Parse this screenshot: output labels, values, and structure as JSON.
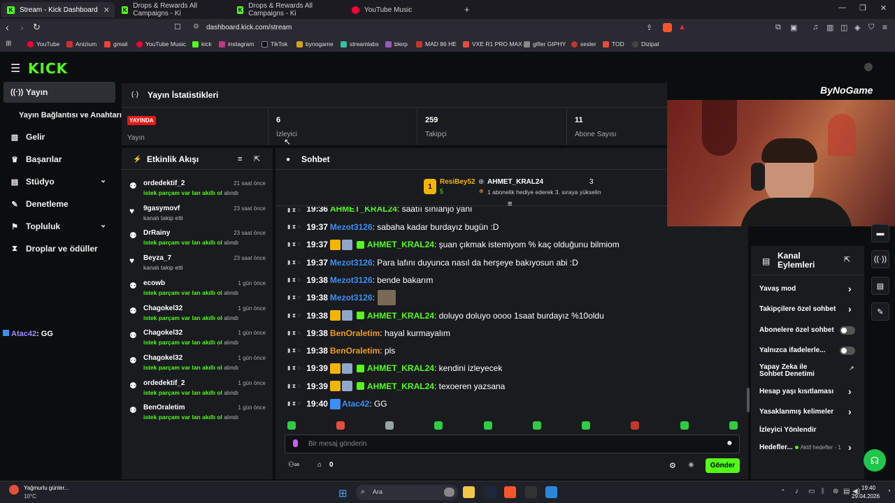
{
  "browser": {
    "tabs": [
      {
        "title": "Stream - Kick Dashboard",
        "icon": "kick-icon"
      },
      {
        "title": "Drops & Rewards All Campaigns - Ki",
        "icon": "kick-icon"
      },
      {
        "title": "Drops & Rewards All Campaigns - Ki",
        "icon": "kick-icon"
      },
      {
        "title": "YouTube Music",
        "icon": "youtube-music-icon"
      }
    ],
    "url": "dashboard.kick.com/stream",
    "bookmarks": [
      "YouTube",
      "Anizium",
      "gmail",
      "YouTube Music",
      "kick",
      "instagram",
      "TikTok",
      "bynogame",
      "streamlabs",
      "blerp",
      "MAD 86 HE",
      "VXE R1 PRO MAX",
      "gifler GIPHY",
      "sesler",
      "TOD",
      "Dizipal"
    ]
  },
  "sidebar": {
    "items": [
      {
        "label": "Yayın",
        "icon": "broadcast-icon"
      },
      {
        "label": "Yayın Bağlantısı ve Anahtarı",
        "icon": ""
      },
      {
        "label": "Gelir",
        "icon": "chart-icon"
      },
      {
        "label": "Başarılar",
        "icon": "trophy-icon"
      },
      {
        "label": "Stüdyo",
        "icon": "studio-icon"
      },
      {
        "label": "Denetleme",
        "icon": "wrench-icon"
      },
      {
        "label": "Topluluk",
        "icon": "community-icon"
      },
      {
        "label": "Droplar ve ödüller",
        "icon": "drops-icon"
      }
    ],
    "overlay_chat": {
      "user": "Atac42",
      "text": ": GG"
    }
  },
  "stats": {
    "title": "Yayın İstatistikleri",
    "live_badge": "YAYINDA",
    "live_label": "Yayın",
    "viewers": {
      "value": "6",
      "label": "İzleyici"
    },
    "followers": {
      "value": "259",
      "label": "Takipçi"
    },
    "subs": {
      "value": "11",
      "label": "Abone Sayısı"
    }
  },
  "activity": {
    "title": "Etkinlik Akışı",
    "items": [
      {
        "user": "ordedektif_2",
        "time": "21 saat önce",
        "desc_bold": "istek parçam var lan akıllı ol",
        "desc": " alındı",
        "kind": "redeem"
      },
      {
        "user": "9gasymovf",
        "time": "23 saat önce",
        "desc_bold": "",
        "desc": "kanalı takip etti",
        "kind": "follow"
      },
      {
        "user": "DrRainy",
        "time": "23 saat önce",
        "desc_bold": "istek parçam var lan akıllı ol",
        "desc": " alındı",
        "kind": "redeem"
      },
      {
        "user": "Beyza_7",
        "time": "23 saat önce",
        "desc_bold": "",
        "desc": "kanalı takip etti",
        "kind": "follow"
      },
      {
        "user": "ecowb",
        "time": "1 gün önce",
        "desc_bold": "istek parçam var lan akıllı ol",
        "desc": " alındı",
        "kind": "redeem"
      },
      {
        "user": "Chagokel32",
        "time": "1 gün önce",
        "desc_bold": "istek parçam var lan akıllı ol",
        "desc": " alındı",
        "kind": "redeem"
      },
      {
        "user": "Chagokel32",
        "time": "1 gün önce",
        "desc_bold": "istek parçam var lan akıllı ol",
        "desc": " alındı",
        "kind": "redeem"
      },
      {
        "user": "Chagokel32",
        "time": "1 gün önce",
        "desc_bold": "istek parçam var lan akıllı ol",
        "desc": " alındı",
        "kind": "redeem"
      },
      {
        "user": "ordedektif_2",
        "time": "1 gün önce",
        "desc_bold": "istek parçam var lan akıllı ol",
        "desc": " alındı",
        "kind": "redeem"
      },
      {
        "user": "BenOraletim",
        "time": "1 gün önce",
        "desc_bold": "istek parçam var lan akıllı ol",
        "desc": " alındı",
        "kind": "redeem"
      }
    ]
  },
  "chat": {
    "title": "Sohbet",
    "pinned": {
      "rank": "1",
      "user1": "ResiBey52",
      "user1_count": "5",
      "user2": "AHMET_KRAL24",
      "user2_count": "3",
      "text": "1 abonelik hediye ederek 3. sıraya yükselin"
    },
    "partial_top": {
      "time": "19:36",
      "user": "AHMET_KRAL24",
      "text": ": saatıı sınıanjo yanı"
    },
    "messages": [
      {
        "time": "19:37",
        "user": "Mezot3126",
        "color": "#3b8ff5",
        "text": ": sabaha kadar burdayız bugün :D",
        "badges": false
      },
      {
        "time": "19:37",
        "user": "AHMET_KRAL24",
        "color": "#53fc18",
        "text": ": şuan çıkmak istemiyom % kaç olduğunu bilmiom",
        "badges": true
      },
      {
        "time": "19:37",
        "user": "Mezot3126",
        "color": "#3b8ff5",
        "text": ": Para lafını duyunca nasıl da herşeye bakıyosun abi :D",
        "badges": false
      },
      {
        "time": "19:38",
        "user": "Mezot3126",
        "color": "#3b8ff5",
        "text": ": bende bakarım",
        "badges": false
      },
      {
        "time": "19:38",
        "user": "Mezot3126",
        "color": "#3b8ff5",
        "text": ":",
        "badges": false,
        "emote": true
      },
      {
        "time": "19:38",
        "user": "AHMET_KRAL24",
        "color": "#53fc18",
        "text": ": doluyo doluyo oooo 1saat burdayız %10oldu",
        "badges": true
      },
      {
        "time": "19:38",
        "user": "BenOraletim",
        "color": "#f39c12",
        "text": ": hayal kurmayalım",
        "badges": false
      },
      {
        "time": "19:38",
        "user": "BenOraletim",
        "color": "#f39c12",
        "text": ": pls",
        "badges": false
      },
      {
        "time": "19:39",
        "user": "AHMET_KRAL24",
        "color": "#53fc18",
        "text": ": kendini izleyecek",
        "badges": true
      },
      {
        "time": "19:39",
        "user": "AHMET_KRAL24",
        "color": "#53fc18",
        "text": ": texoeren yazsana",
        "badges": true
      },
      {
        "time": "19:40",
        "user": "Atac42",
        "color": "#3b8ff5",
        "text": ": GG",
        "badges": false,
        "ic": true
      }
    ],
    "input_placeholder": "Bir mesaj gönderin",
    "points": "0",
    "send_label": "Gönder"
  },
  "actions": {
    "title_line1": "Kanal",
    "title_line2": "Eylemleri",
    "items": [
      {
        "label": "Yavaş mod",
        "control": "chevron"
      },
      {
        "label": "Takipçilere özel sohbet",
        "control": "chevron"
      },
      {
        "label": "Abonelere özel sohbet",
        "control": "toggle"
      },
      {
        "label": "Yalnızca ifadelerle...",
        "control": "toggle"
      },
      {
        "label": "Yapay Zeka ile Sohbet Denetimi",
        "control": "external"
      },
      {
        "label": "Hesap yaşı kısıtlaması",
        "control": "chevron"
      },
      {
        "label": "Yasaklanmış kelimeler",
        "control": "chevron"
      },
      {
        "label": "İzleyici Yönlendir",
        "control": "none"
      },
      {
        "label": "Hedefler...",
        "control": "chevron",
        "sub": "Aktif hedefler - 1"
      }
    ]
  },
  "overlay_brand": "ByNoGame",
  "taskbar": {
    "weather_title": "Yağmurlu günler...",
    "weather_temp": "10°C",
    "search_label": "Ara",
    "clock_time": "19:40",
    "clock_date": "29.04.2026"
  },
  "colors": {
    "kick_green": "#53fc18",
    "live_red": "#e91916"
  }
}
